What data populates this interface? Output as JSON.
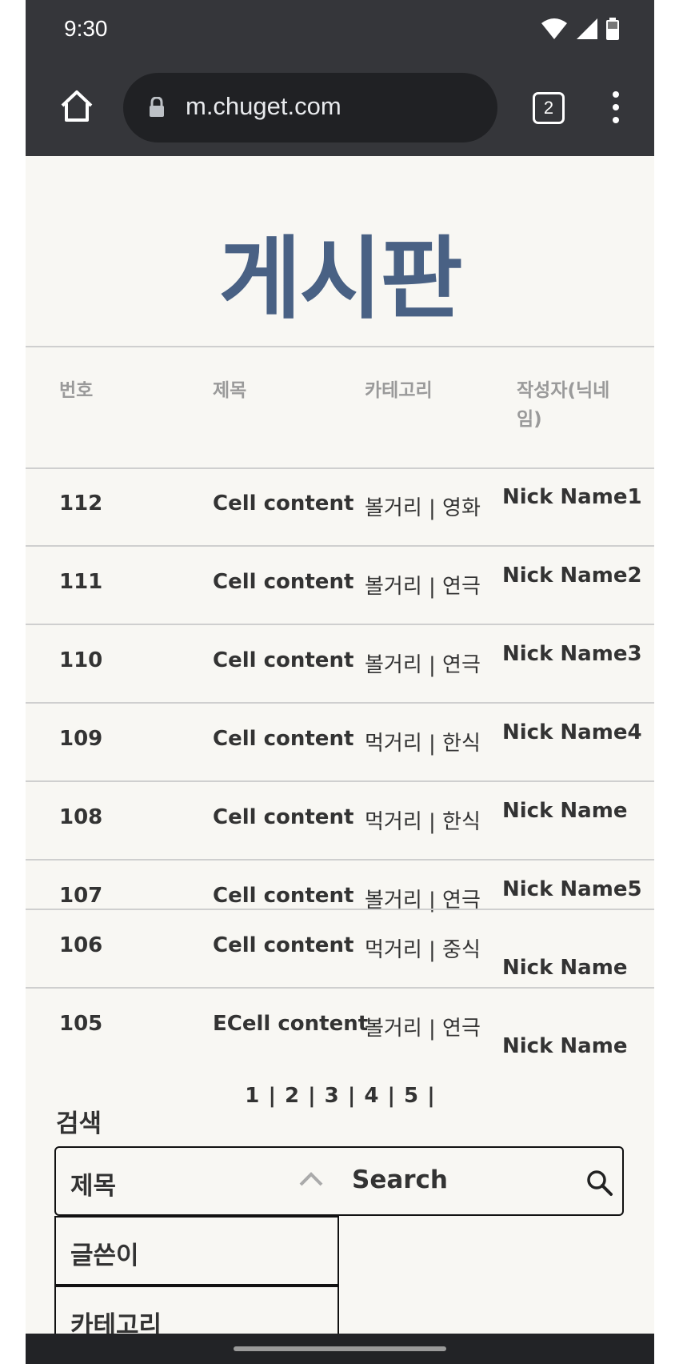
{
  "status_bar": {
    "time": "9:30"
  },
  "browser": {
    "url": "m.chuget.com",
    "tab_count": "2"
  },
  "page": {
    "title": "게시판"
  },
  "table": {
    "headers": [
      "번호",
      "제목",
      "카테고리",
      "작성자(닉네임)"
    ],
    "rows": [
      {
        "no": "112",
        "title": "Cell content",
        "category": "볼거리 | 영화",
        "author": "Nick Name1"
      },
      {
        "no": "111",
        "title": "Cell content",
        "category": "볼거리 | 연극",
        "author": "Nick Name2"
      },
      {
        "no": "110",
        "title": "Cell content",
        "category": "볼거리 | 연극",
        "author": "Nick Name3"
      },
      {
        "no": "109",
        "title": "Cell content",
        "category": "먹거리 | 한식",
        "author": "Nick Name4"
      },
      {
        "no": "108",
        "title": "Cell content",
        "category": "먹거리 | 한식",
        "author": "Nick Name"
      },
      {
        "no": "107",
        "title": "Cell content",
        "category": "볼거리 | 연극",
        "author": "Nick Name5"
      },
      {
        "no": "106",
        "title": "Cell content",
        "category": "먹거리 | 중식",
        "author": "Nick Name"
      },
      {
        "no": "105",
        "title": "ECell content",
        "category": "볼거리 | 연극",
        "author": "Nick Name"
      }
    ]
  },
  "pagination": {
    "text": "1 | 2 | 3 | 4 | 5 |"
  },
  "search": {
    "label": "검색",
    "selected_option": "제목",
    "options": [
      "글쓴이",
      "카테고리"
    ],
    "input_placeholder": "Search"
  }
}
